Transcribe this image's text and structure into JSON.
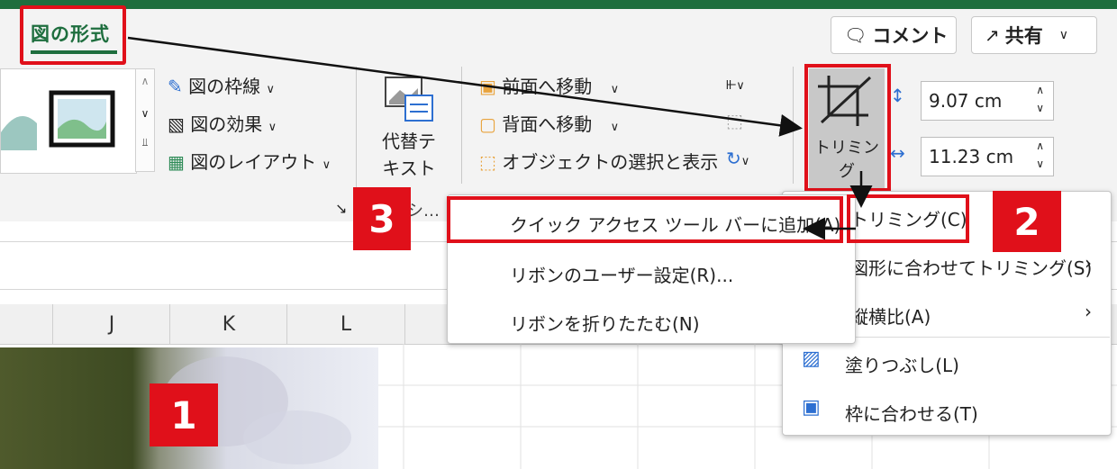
{
  "ribbon": {
    "active_tab": "図の形式",
    "comment_button": "コメント",
    "share_button": "共有",
    "picture_border": "図の枠線",
    "picture_effects": "図の効果",
    "picture_layout": "図のレイアウト",
    "alt_text_line1": "代替テ",
    "alt_text_line2": "キスト",
    "group_label_truncated": "シ…",
    "bring_forward": "前面へ移動",
    "send_backward": "背面へ移動",
    "selection_pane": "オブジェクトの選択と表示",
    "crop_button": "トリミング",
    "height_value": "9.07 cm",
    "width_value": "11.23 cm"
  },
  "columns": [
    "J",
    "K",
    "L"
  ],
  "context_menu": {
    "items": [
      {
        "label": "クイック アクセス ツール バーに追加(A)"
      },
      {
        "label": "リボンのユーザー設定(R)..."
      },
      {
        "label": "リボンを折りたたむ(N)"
      }
    ]
  },
  "crop_menu": {
    "items": [
      {
        "label": "トリミング(C)"
      },
      {
        "label": "図形に合わせてトリミング(S)"
      },
      {
        "label": "縦横比(A)"
      },
      {
        "label": "塗りつぶし(L)"
      },
      {
        "label": "枠に合わせる(T)"
      }
    ]
  },
  "callouts": {
    "one": "1",
    "two": "2",
    "three": "3"
  },
  "colors": {
    "accent": "#1e6e3e",
    "callout": "#e0101a"
  }
}
